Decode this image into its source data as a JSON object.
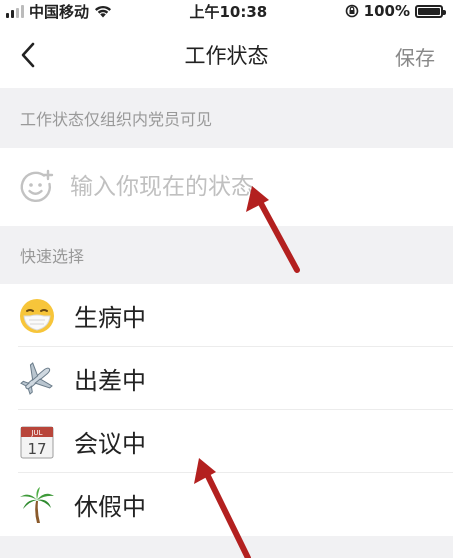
{
  "status_bar": {
    "carrier": "中国移动",
    "time": "上午10:38",
    "battery": "100%",
    "battery_level": 1.0
  },
  "nav": {
    "title": "工作状态",
    "save_label": "保存"
  },
  "hint": "工作状态仅组织内党员可见",
  "input": {
    "placeholder": "输入你现在的状态",
    "value": ""
  },
  "quick_section_label": "快速选择",
  "quick_items": [
    {
      "label": "生病中",
      "icon": "sick-mask-emoji-icon"
    },
    {
      "label": "出差中",
      "icon": "airplane-emoji-icon"
    },
    {
      "label": "会议中",
      "icon": "calendar-emoji-icon"
    },
    {
      "label": "休假中",
      "icon": "palm-tree-emoji-icon"
    }
  ],
  "calendar_icon": {
    "month": "JUL",
    "day": "17"
  },
  "colors": {
    "accent": "#999999",
    "annotation_arrow": "#b3201f"
  }
}
